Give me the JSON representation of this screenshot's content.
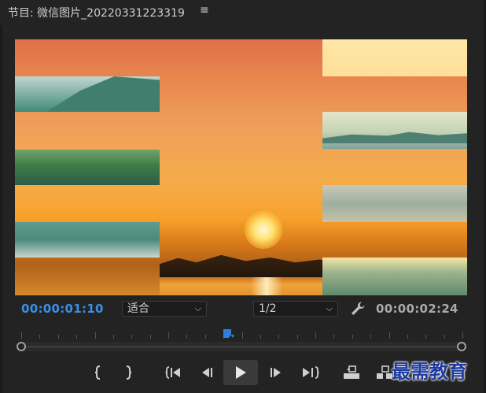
{
  "panel": {
    "title": "节目: 微信图片_20220331223319",
    "menu_glyph": "≡"
  },
  "monitor": {
    "current_timecode": "00:00:01:10",
    "duration_timecode": "00:00:02:24",
    "zoom_value": "适合",
    "resolution_value": "1/2",
    "chevron_glyph": "⌵"
  },
  "timeline": {
    "playhead_position_fraction": 0.47
  },
  "transport": {
    "buttons": [
      "mark-in",
      "mark-out",
      "go-to-in",
      "step-back",
      "play",
      "step-forward",
      "go-to-out",
      "lift",
      "extract"
    ]
  },
  "watermark": {
    "text": "最需教育"
  },
  "colors": {
    "timecode_active": "#3a8fe6",
    "playhead": "#2f7fe0",
    "background": "#232323"
  }
}
